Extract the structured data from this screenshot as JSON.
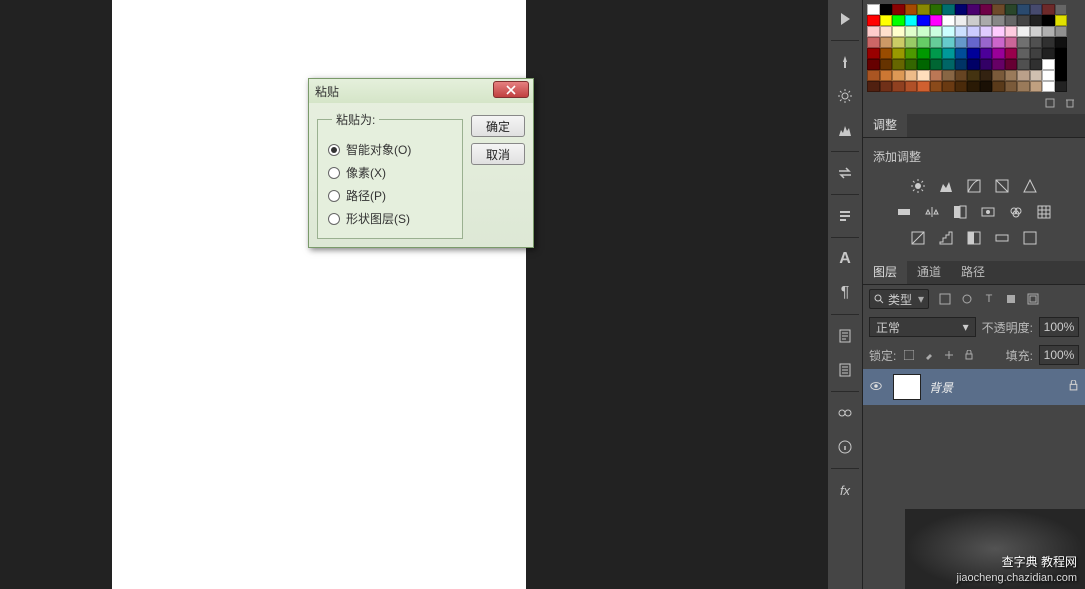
{
  "dialog": {
    "title": "粘贴",
    "group_label": "粘贴为:",
    "options": [
      {
        "label": "智能对象(O)",
        "checked": true
      },
      {
        "label": "像素(X)",
        "checked": false
      },
      {
        "label": "路径(P)",
        "checked": false
      },
      {
        "label": "形状图层(S)",
        "checked": false
      }
    ],
    "ok": "确定",
    "cancel": "取消"
  },
  "swatches": {
    "colors": [
      "#ffffff",
      "#000000",
      "#8a0000",
      "#a64a00",
      "#8a8a00",
      "#2a6e00",
      "#006e6e",
      "#00006e",
      "#4a006e",
      "#6e0046",
      "#6e4a2a",
      "#2a462a",
      "#2a4a6e",
      "#464a6e",
      "#6e2a2a",
      "#666666",
      "#ff0000",
      "#ffff00",
      "#00ff00",
      "#00ffff",
      "#0000ff",
      "#ff00ff",
      "#ffffff",
      "#eeeeee",
      "#cccccc",
      "#aaaaaa",
      "#888888",
      "#666666",
      "#444444",
      "#222222",
      "#000000",
      "#e0e000",
      "#ffcccc",
      "#ffe0cc",
      "#ffffcc",
      "#e0ffcc",
      "#ccffcc",
      "#ccffe0",
      "#ccffff",
      "#cce0ff",
      "#ccccff",
      "#e0ccff",
      "#ffccff",
      "#ffcce0",
      "#f0f0f0",
      "#d0d0d0",
      "#b0b0b0",
      "#909090",
      "#cc6666",
      "#cc9966",
      "#cccc66",
      "#99cc66",
      "#66cc66",
      "#66cc99",
      "#66cccc",
      "#6699cc",
      "#6666cc",
      "#9966cc",
      "#cc66cc",
      "#cc6699",
      "#707070",
      "#505050",
      "#303030",
      "#101010",
      "#990000",
      "#994c00",
      "#999900",
      "#4c9900",
      "#009900",
      "#00994c",
      "#009999",
      "#004c99",
      "#000099",
      "#4c0099",
      "#990099",
      "#99004c",
      "#606060",
      "#404040",
      "#202020",
      "#000000",
      "#660000",
      "#663300",
      "#666600",
      "#336600",
      "#006600",
      "#006633",
      "#006666",
      "#003366",
      "#000066",
      "#330066",
      "#660066",
      "#660033",
      "#505050",
      "#303030",
      "#ffffff",
      "#000000",
      "#aa5522",
      "#cc7733",
      "#dd9955",
      "#eebb88",
      "#ffddbb",
      "#bb7755",
      "#886644",
      "#664422",
      "#443311",
      "#332211",
      "#7a5a3a",
      "#9a7a5a",
      "#baa08a",
      "#d0c0b0",
      "#ffffff",
      "#000000",
      "#502010",
      "#703018",
      "#904020",
      "#b05028",
      "#d06030",
      "#8a4a1a",
      "#6a3a12",
      "#4a2a0a",
      "#2a1a05",
      "#1a1005",
      "#5a3a1a",
      "#7a5a3a",
      "#9a7a5a",
      "#c0a080",
      "#ffffff",
      "#222222"
    ]
  },
  "adjust_tab": {
    "label": "调整"
  },
  "adjust": {
    "title": "添加调整"
  },
  "layer_tabs": {
    "items": [
      {
        "label": "图层",
        "active": true
      },
      {
        "label": "通道",
        "active": false
      },
      {
        "label": "路径",
        "active": false
      }
    ]
  },
  "layers": {
    "type_filter": "类型",
    "blend_mode": "正常",
    "opacity_label": "不透明度:",
    "opacity_value": "100%",
    "lock_label": "锁定:",
    "fill_label": "填充:",
    "fill_value": "100%",
    "items": [
      {
        "name": "背景",
        "locked": true
      }
    ]
  },
  "watermark": {
    "main": "查字典 教程网",
    "sub": "jiaocheng.chazidian.com"
  }
}
